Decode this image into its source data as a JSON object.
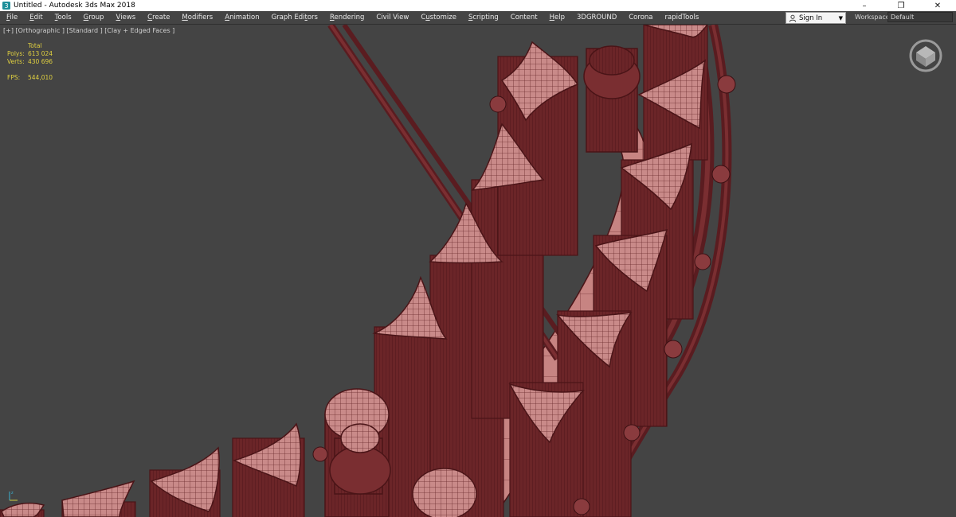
{
  "window": {
    "title": "Untitled - Autodesk 3ds Max 2018",
    "minimize": "–",
    "restore": "❐",
    "close": "✕"
  },
  "menu": {
    "items": [
      {
        "pre": "",
        "u": "F",
        "post": "ile"
      },
      {
        "pre": "",
        "u": "E",
        "post": "dit"
      },
      {
        "pre": "",
        "u": "T",
        "post": "ools"
      },
      {
        "pre": "",
        "u": "G",
        "post": "roup"
      },
      {
        "pre": "",
        "u": "V",
        "post": "iews"
      },
      {
        "pre": "",
        "u": "C",
        "post": "reate"
      },
      {
        "pre": "",
        "u": "M",
        "post": "odifiers"
      },
      {
        "pre": "",
        "u": "A",
        "post": "nimation"
      },
      {
        "pre": "Graph Edi",
        "u": "t",
        "post": "ors"
      },
      {
        "pre": "",
        "u": "R",
        "post": "endering"
      },
      {
        "pre": "Civil View",
        "u": "",
        "post": ""
      },
      {
        "pre": "C",
        "u": "u",
        "post": "stomize"
      },
      {
        "pre": "",
        "u": "S",
        "post": "cripting"
      },
      {
        "pre": "Content",
        "u": "",
        "post": ""
      },
      {
        "pre": "",
        "u": "H",
        "post": "elp"
      },
      {
        "pre": "3DGROUND",
        "u": "",
        "post": ""
      },
      {
        "pre": "Corona",
        "u": "",
        "post": ""
      },
      {
        "pre": "rapidTools",
        "u": "",
        "post": ""
      }
    ],
    "signin": "Sign In",
    "workspaces_label": "Workspaces:",
    "workspace": "Default"
  },
  "viewport": {
    "label": "[+] [Orthographic ] [Standard ] [Clay + Edged Faces ]",
    "stats": {
      "header": "Total",
      "polys_label": "Polys:",
      "polys": "613 024",
      "verts_label": "Verts:",
      "verts": "430 696",
      "fps_label": "FPS:",
      "fps": "544,010"
    }
  },
  "colors": {
    "background": "#444444",
    "model": "#8a3b3e",
    "model_dark": "#5a1c20",
    "model_light": "#c07a78",
    "stats_text": "#e0d040"
  }
}
